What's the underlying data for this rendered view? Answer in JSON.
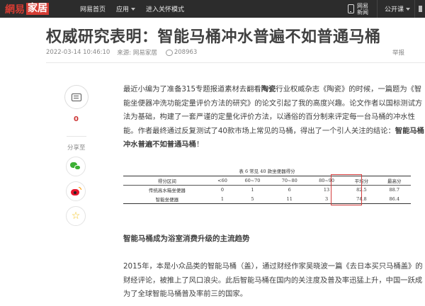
{
  "topbar": {
    "logo_main": "網易",
    "logo_sub": "家居",
    "nav": [
      {
        "label": "网易首页",
        "has_dropdown": false
      },
      {
        "label": "应用",
        "has_dropdown": true
      },
      {
        "label": "进入关怀模式",
        "has_dropdown": false
      }
    ],
    "app_label": "网易新闻",
    "open_course": "公开课"
  },
  "article": {
    "title": "权威研究表明：智能马桶冲水普遍不如普通马桶",
    "date": "2022-03-14 10:46:10",
    "source": "来源: 网易家居",
    "views": "208963",
    "report": "举报",
    "paragraph1": {
      "segments": [
        {
          "text": "最近小编为了准备315专题报道素材去翻看",
          "bold": false
        },
        {
          "text": "陶瓷",
          "bold": true
        },
        {
          "text": "行业权威杂志《陶瓷》的时候，一篇题为《智能坐便器冲洗功能定量评价方法的研究》的论文引起了我的高度兴趣。论文作者以国标测试方法为基础，构建了一套严谨的定量化评价方法，以通俗的百分制来评定每一台马桶的冲水性能。作者最终通过反复测试了40款市场上常见的马桶，得出了一个引人关注的结论：",
          "bold": false
        },
        {
          "text": "智能马桶冲水普遍不如普通马桶",
          "bold": true
        },
        {
          "text": "！",
          "bold": false
        }
      ]
    },
    "table": {
      "caption": "表 6  常见 40 款坐便器得分",
      "headers": [
        "得分区间",
        "<60",
        "60~70",
        "70~80",
        "80~90",
        "平均分",
        "最高分"
      ],
      "rows": [
        [
          "传统高水箱坐便器",
          "0",
          "1",
          "6",
          "13",
          "82.5",
          "88.7"
        ],
        [
          "智能坐便器",
          "1",
          "5",
          "11",
          "3",
          "74.8",
          "86.4"
        ]
      ]
    },
    "subtitle": {
      "segments": [
        {
          "text": "智能马桶成为",
          "underline": false
        },
        {
          "text": "浴室",
          "underline": true
        },
        {
          "text": "消费升级的主流趋势",
          "underline": false
        }
      ]
    },
    "paragraph2": "2015年，本是小众品类的智能马桶（盖），通过财经作家吴晓波一篇《去日本买只马桶盖》的财经评论，被推上了风口浪尖。此后智能马桶在国内的关注度及普及率迅猛上升，中国一跃成为了全球智能马桶普及率前三的国家。"
  },
  "sidebar": {
    "comment_count": "0",
    "share_label": "分享至",
    "share_targets": [
      "wechat-icon",
      "weibo-icon",
      "favorite-icon"
    ]
  },
  "colors": {
    "topbar_bg": "#2c2c2c",
    "brand_red": "#d43c33",
    "highlight_red": "#d23c3c",
    "wechat_green": "#3cb034",
    "weibo_red": "#e6162d",
    "star_yellow": "#f3c21c"
  }
}
